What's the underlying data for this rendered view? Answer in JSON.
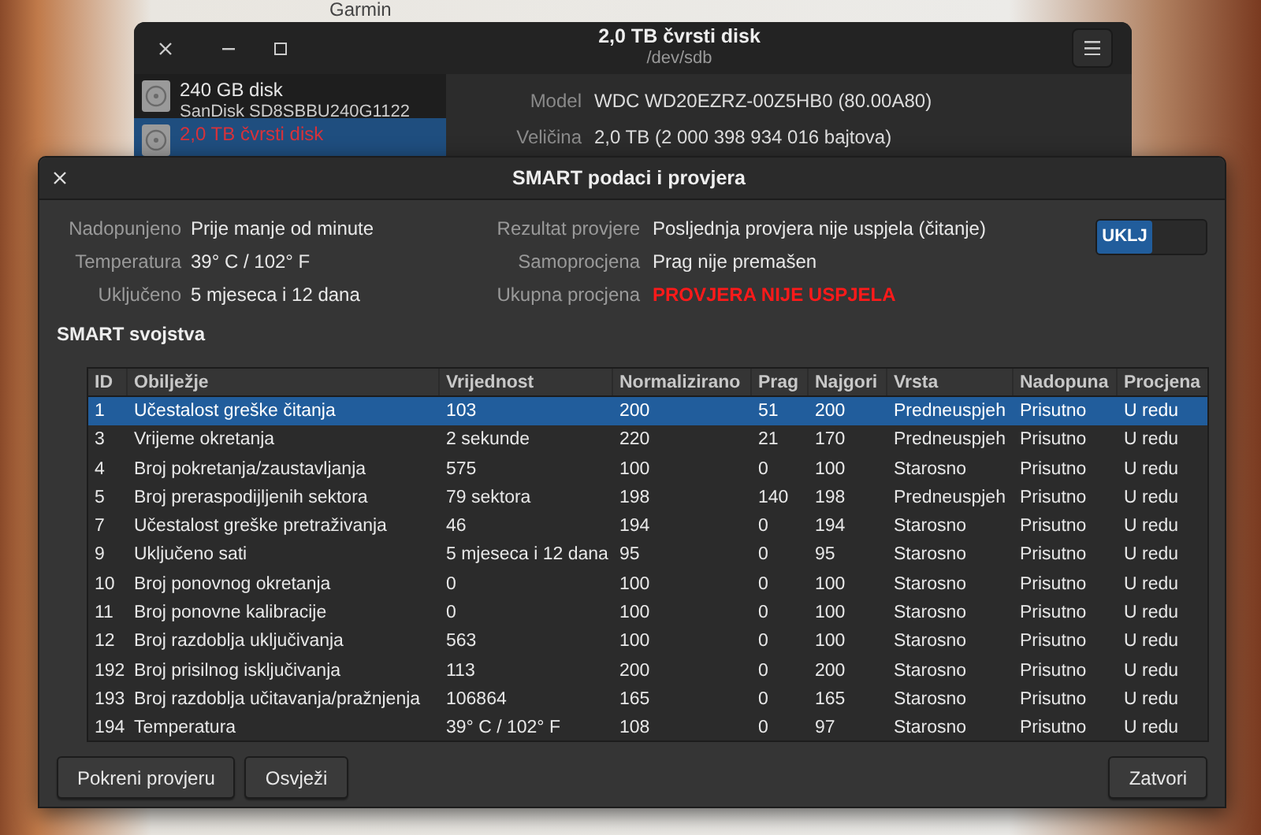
{
  "desktop": {
    "icon_label": "Garmin"
  },
  "main_window": {
    "title": "2,0 TB čvrsti disk",
    "subtitle": "/dev/sdb",
    "drives": [
      {
        "name": "240 GB disk",
        "detail": "SanDisk SD8SBBU240G1122",
        "selected": false
      },
      {
        "name": "2,0 TB čvrsti disk",
        "selected": true
      }
    ],
    "details": [
      {
        "label": "Model",
        "value": "WDC WD20EZRZ-00Z5HB0 (80.00A80)"
      },
      {
        "label": "Veličina",
        "value": "2,0 TB (2 000 398 934 016 bajtova)"
      }
    ]
  },
  "smart_dialog": {
    "title": "SMART podaci i provjera",
    "summary_left": [
      {
        "label": "Nadopunjeno",
        "value": "Prije manje od minute"
      },
      {
        "label": "Temperatura",
        "value": "39° C / 102° F"
      },
      {
        "label": "Uključeno",
        "value": "5 mjeseca i 12 dana"
      }
    ],
    "summary_right": [
      {
        "label": "Rezultat provjere",
        "value": "Posljednja provjera nije uspjela (čitanje)",
        "alert": false
      },
      {
        "label": "Samoprocjena",
        "value": "Prag nije premašen",
        "alert": false
      },
      {
        "label": "Ukupna procjena",
        "value": "PROVJERA NIJE USPJELA",
        "alert": true
      }
    ],
    "switch": {
      "label": "UKLJ",
      "on": true
    },
    "section_title": "SMART svojstva",
    "table": {
      "columns": [
        "ID",
        "Obilježje",
        "Vrijednost",
        "Normalizirano",
        "Prag",
        "Najgori",
        "Vrsta",
        "Nadopuna",
        "Procjena"
      ],
      "rows": [
        {
          "cells": [
            "1",
            "Učestalost greške čitanja",
            "103",
            "200",
            "51",
            "200",
            "Predneuspjeh",
            "Prisutno",
            "U redu"
          ],
          "selected": true
        },
        {
          "cells": [
            "3",
            "Vrijeme okretanja",
            "2 sekunde",
            "220",
            "21",
            "170",
            "Predneuspjeh",
            "Prisutno",
            "U redu"
          ],
          "selected": false
        },
        {
          "cells": [
            "4",
            "Broj pokretanja/zaustavljanja",
            "575",
            "100",
            "0",
            "100",
            "Starosno",
            "Prisutno",
            "U redu"
          ],
          "selected": false
        },
        {
          "cells": [
            "5",
            "Broj preraspodijljenih sektora",
            "79 sektora",
            "198",
            "140",
            "198",
            "Predneuspjeh",
            "Prisutno",
            "U redu"
          ],
          "selected": false
        },
        {
          "cells": [
            "7",
            "Učestalost greške pretraživanja",
            "46",
            "194",
            "0",
            "194",
            "Starosno",
            "Prisutno",
            "U redu"
          ],
          "selected": false
        },
        {
          "cells": [
            "9",
            "Uključeno sati",
            "5 mjeseca i 12 dana",
            "95",
            "0",
            "95",
            "Starosno",
            "Prisutno",
            "U redu"
          ],
          "selected": false
        },
        {
          "cells": [
            "10",
            "Broj ponovnog okretanja",
            "0",
            "100",
            "0",
            "100",
            "Starosno",
            "Prisutno",
            "U redu"
          ],
          "selected": false
        },
        {
          "cells": [
            "11",
            "Broj ponovne kalibracije",
            "0",
            "100",
            "0",
            "100",
            "Starosno",
            "Prisutno",
            "U redu"
          ],
          "selected": false
        },
        {
          "cells": [
            "12",
            "Broj razdoblja uključivanja",
            "563",
            "100",
            "0",
            "100",
            "Starosno",
            "Prisutno",
            "U redu"
          ],
          "selected": false
        },
        {
          "cells": [
            "192",
            "Broj prisilnog isključivanja",
            "113",
            "200",
            "0",
            "200",
            "Starosno",
            "Prisutno",
            "U redu"
          ],
          "selected": false
        },
        {
          "cells": [
            "193",
            "Broj razdoblja učitavanja/pražnjenja",
            "106864",
            "165",
            "0",
            "165",
            "Starosno",
            "Prisutno",
            "U redu"
          ],
          "selected": false
        },
        {
          "cells": [
            "194",
            "Temperatura",
            "39° C / 102° F",
            "108",
            "0",
            "97",
            "Starosno",
            "Prisutno",
            "U redu"
          ],
          "selected": false
        }
      ]
    },
    "buttons_left": [
      "Pokreni provjeru",
      "Osvježi"
    ],
    "buttons_right": [
      "Zatvori"
    ]
  }
}
